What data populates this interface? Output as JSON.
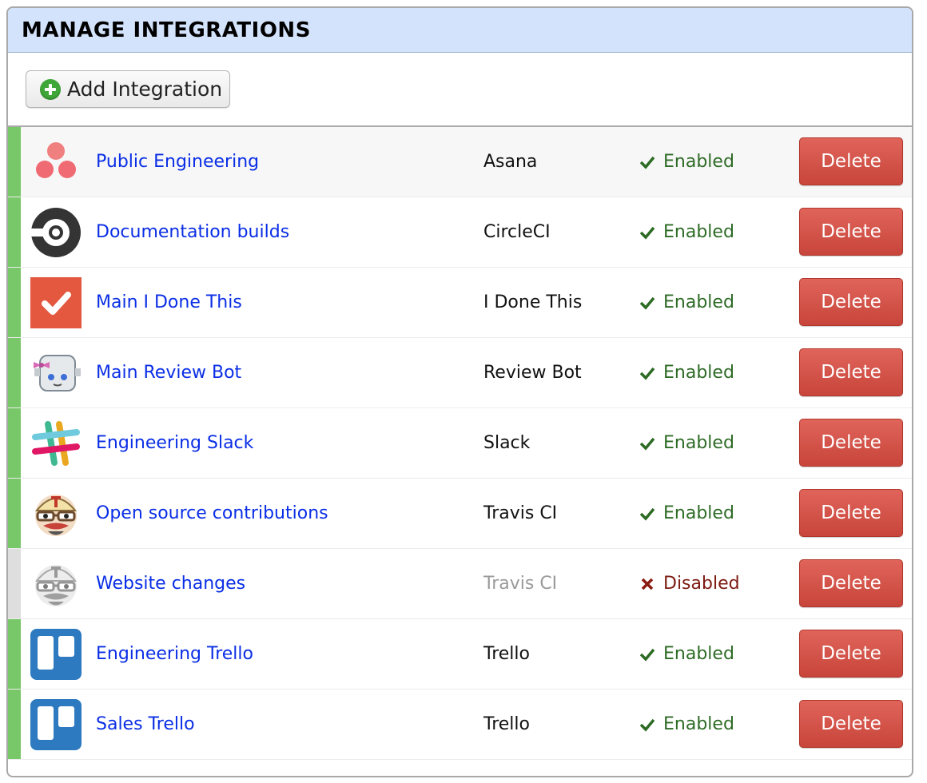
{
  "panel": {
    "title": "MANAGE INTEGRATIONS",
    "add_button_label": "Add Integration"
  },
  "colors": {
    "header_bg": "#d4e3fc",
    "enabled_bar": "#78c86a",
    "disabled_bar": "#dedede",
    "link": "#0a2ee6",
    "enabled_text": "#2d6b25",
    "disabled_text": "#7d1b12",
    "delete_button": "#d3544a"
  },
  "integrations": [
    {
      "name": "Public Engineering",
      "service": "Asana",
      "status": "Enabled",
      "enabled": true,
      "icon": "asana-icon",
      "delete_label": "Delete"
    },
    {
      "name": "Documentation builds",
      "service": "CircleCI",
      "status": "Enabled",
      "enabled": true,
      "icon": "circleci-icon",
      "delete_label": "Delete"
    },
    {
      "name": "Main I Done This",
      "service": "I Done This",
      "status": "Enabled",
      "enabled": true,
      "icon": "idonethis-icon",
      "delete_label": "Delete"
    },
    {
      "name": "Main Review Bot",
      "service": "Review Bot",
      "status": "Enabled",
      "enabled": true,
      "icon": "reviewbot-icon",
      "delete_label": "Delete"
    },
    {
      "name": "Engineering Slack",
      "service": "Slack",
      "status": "Enabled",
      "enabled": true,
      "icon": "slack-icon",
      "delete_label": "Delete"
    },
    {
      "name": "Open source contributions",
      "service": "Travis CI",
      "status": "Enabled",
      "enabled": true,
      "icon": "travisci-icon",
      "delete_label": "Delete"
    },
    {
      "name": "Website changes",
      "service": "Travis CI",
      "status": "Disabled",
      "enabled": false,
      "icon": "travisci-icon",
      "delete_label": "Delete"
    },
    {
      "name": "Engineering Trello",
      "service": "Trello",
      "status": "Enabled",
      "enabled": true,
      "icon": "trello-icon",
      "delete_label": "Delete"
    },
    {
      "name": "Sales Trello",
      "service": "Trello",
      "status": "Enabled",
      "enabled": true,
      "icon": "trello-icon",
      "delete_label": "Delete"
    }
  ]
}
